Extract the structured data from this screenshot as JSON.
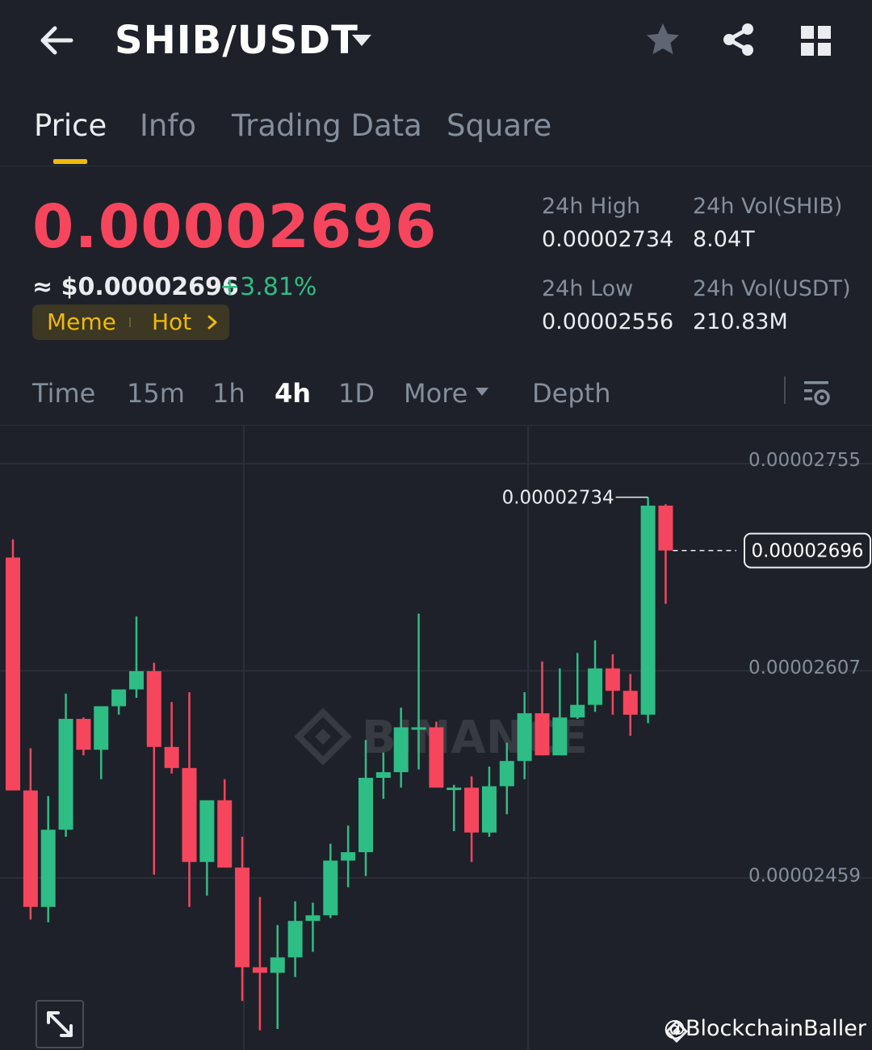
{
  "header": {
    "pair": "SHIB/USDT",
    "back_icon": "arrow-left-icon",
    "pair_dropdown_icon": "caret-down-icon",
    "favorite_icon": "star-icon",
    "share_icon": "share-icon",
    "grid_icon": "grid-icon"
  },
  "tabs": [
    {
      "label": "Price",
      "active": true
    },
    {
      "label": "Info",
      "active": false
    },
    {
      "label": "Trading Data",
      "active": false
    },
    {
      "label": "Square",
      "active": false
    }
  ],
  "price": {
    "last": "0.00002696",
    "usd_approx": "≈ $0.00002696",
    "change": "+3.81%",
    "tags": [
      "Meme",
      "Hot"
    ]
  },
  "stats": {
    "high_label": "24h High",
    "high_value": "0.00002734",
    "low_label": "24h Low",
    "low_value": "0.00002556",
    "vol_base_label": "24h Vol(SHIB)",
    "vol_base_value": "8.04T",
    "vol_quote_label": "24h Vol(USDT)",
    "vol_quote_value": "210.83M"
  },
  "intervals": {
    "items": [
      "Time",
      "15m",
      "1h",
      "4h",
      "1D",
      "More",
      "Depth"
    ],
    "active": "4h",
    "settings_icon": "chart-settings-icon"
  },
  "chart_data": {
    "type": "candlestick",
    "y_ticks": [
      "0.00002755",
      "0.00002607",
      "0.00002459"
    ],
    "ylim": [
      2.34e-05,
      2.785e-05
    ],
    "high_marker": "0.00002734",
    "last_price_marker": "0.00002696",
    "watermark": "BINANCE",
    "colors": {
      "up": "#2ebd85",
      "down": "#f6465d"
    },
    "candles": [
      {
        "o": 2.691e-05,
        "h": 2.704e-05,
        "l": 2.614e-05,
        "c": 2.525e-05
      },
      {
        "o": 2.525e-05,
        "h": 2.555e-05,
        "l": 2.433e-05,
        "c": 2.442e-05
      },
      {
        "o": 2.442e-05,
        "h": 2.521e-05,
        "l": 2.431e-05,
        "c": 2.497e-05
      },
      {
        "o": 2.497e-05,
        "h": 2.594e-05,
        "l": 2.492e-05,
        "c": 2.576e-05
      },
      {
        "o": 2.576e-05,
        "h": 2.577e-05,
        "l": 2.55e-05,
        "c": 2.554e-05
      },
      {
        "o": 2.554e-05,
        "h": 2.584e-05,
        "l": 2.533e-05,
        "c": 2.585e-05
      },
      {
        "o": 2.585e-05,
        "h": 2.593e-05,
        "l": 2.579e-05,
        "c": 2.597e-05
      },
      {
        "o": 2.597e-05,
        "h": 2.649e-05,
        "l": 2.591e-05,
        "c": 2.61e-05
      },
      {
        "o": 2.61e-05,
        "h": 2.616e-05,
        "l": 2.465e-05,
        "c": 2.556e-05
      },
      {
        "o": 2.556e-05,
        "h": 2.588e-05,
        "l": 2.537e-05,
        "c": 2.541e-05
      },
      {
        "o": 2.541e-05,
        "h": 2.595e-05,
        "l": 2.442e-05,
        "c": 2.474e-05
      },
      {
        "o": 2.474e-05,
        "h": 2.514e-05,
        "l": 2.45e-05,
        "c": 2.518e-05
      },
      {
        "o": 2.518e-05,
        "h": 2.533e-05,
        "l": 2.486e-05,
        "c": 2.47e-05
      },
      {
        "o": 2.47e-05,
        "h": 2.492e-05,
        "l": 2.375e-05,
        "c": 2.399e-05
      },
      {
        "o": 2.399e-05,
        "h": 2.449e-05,
        "l": 2.354e-05,
        "c": 2.395e-05
      },
      {
        "o": 2.395e-05,
        "h": 2.429e-05,
        "l": 2.355e-05,
        "c": 2.406e-05
      },
      {
        "o": 2.406e-05,
        "h": 2.446e-05,
        "l": 2.392e-05,
        "c": 2.432e-05
      },
      {
        "o": 2.432e-05,
        "h": 2.445e-05,
        "l": 2.41e-05,
        "c": 2.436e-05
      },
      {
        "o": 2.436e-05,
        "h": 2.487e-05,
        "l": 2.434e-05,
        "c": 2.475e-05
      },
      {
        "o": 2.475e-05,
        "h": 2.5e-05,
        "l": 2.456e-05,
        "c": 2.481e-05
      },
      {
        "o": 2.481e-05,
        "h": 2.561e-05,
        "l": 2.464e-05,
        "c": 2.534e-05
      },
      {
        "o": 2.534e-05,
        "h": 2.552e-05,
        "l": 2.519e-05,
        "c": 2.538e-05
      },
      {
        "o": 2.538e-05,
        "h": 2.584e-05,
        "l": 2.527e-05,
        "c": 2.57e-05
      },
      {
        "o": 2.57e-05,
        "h": 2.651e-05,
        "l": 2.54e-05,
        "c": 2.57e-05
      },
      {
        "o": 2.57e-05,
        "h": 2.574e-05,
        "l": 2.528e-05,
        "c": 2.527e-05
      },
      {
        "o": 2.527e-05,
        "h": 2.529e-05,
        "l": 2.496e-05,
        "c": 2.527e-05
      },
      {
        "o": 2.527e-05,
        "h": 2.535e-05,
        "l": 2.474e-05,
        "c": 2.495e-05
      },
      {
        "o": 2.495e-05,
        "h": 2.542e-05,
        "l": 2.492e-05,
        "c": 2.528e-05
      },
      {
        "o": 2.528e-05,
        "h": 2.559e-05,
        "l": 2.508e-05,
        "c": 2.546e-05
      },
      {
        "o": 2.546e-05,
        "h": 2.595e-05,
        "l": 2.533e-05,
        "c": 2.58e-05
      },
      {
        "o": 2.58e-05,
        "h": 2.617e-05,
        "l": 2.55e-05,
        "c": 2.55e-05
      },
      {
        "o": 2.55e-05,
        "h": 2.612e-05,
        "l": 2.551e-05,
        "c": 2.577e-05
      },
      {
        "o": 2.577e-05,
        "h": 2.623e-05,
        "l": 2.576e-05,
        "c": 2.586e-05
      },
      {
        "o": 2.586e-05,
        "h": 2.632e-05,
        "l": 2.581e-05,
        "c": 2.612e-05
      },
      {
        "o": 2.612e-05,
        "h": 2.622e-05,
        "l": 2.579e-05,
        "c": 2.596e-05
      },
      {
        "o": 2.596e-05,
        "h": 2.608e-05,
        "l": 2.564e-05,
        "c": 2.579e-05
      },
      {
        "o": 2.579e-05,
        "h": 2.734e-05,
        "l": 2.573e-05,
        "c": 2.728e-05
      },
      {
        "o": 2.728e-05,
        "h": 2.729e-05,
        "l": 2.658e-05,
        "c": 2.696e-05
      }
    ]
  },
  "footer": {
    "expand_icon": "expand-icon",
    "watermark_user": "@BlockchainBaller"
  }
}
